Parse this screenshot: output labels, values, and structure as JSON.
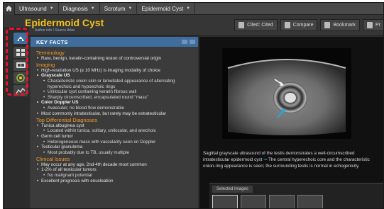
{
  "breadcrumb": {
    "items": [
      "Ultrasound",
      "Diagnosis",
      "Scrotum",
      "Epidermoid Cyst"
    ]
  },
  "header": {
    "title": "Epidermoid Cyst",
    "subtitle": "Author info / Source Atlas",
    "tools": [
      "Cited: Cited",
      "Compare",
      "Bookmark",
      "Pr"
    ]
  },
  "panel": {
    "title": "KEY FACTS",
    "terminology": {
      "heading": "Terminology",
      "items": [
        "Rare, benign, keratin-containing lesion of controversial origin"
      ]
    },
    "imaging": {
      "heading": "Imaging",
      "item1": "High-resolution US (≥ 10 MHz) is imaging modality of choice",
      "grayscale_label": "Grayscale US",
      "grayscale_items": [
        "Characteristic onion skin or lamellated appearance of alternating hyperechoic and hypoechoic rings",
        "Unilocular cyst containing keratin fibrous wall",
        "Sharply circumscribed, encapsulated round \"mass\""
      ],
      "doppler_label": "Color Doppler US",
      "doppler_items": [
        "Avascular; no blood flow demonstrable"
      ],
      "item_last": "Most commonly intratesticular, but rarely may be extratesticular"
    },
    "differential": {
      "heading": "Top Differential Diagnoses",
      "items": [
        "Tunica albuginea cyst",
        "Located within tunica, solitary, unilocular, and anechoic",
        "Germ cell tumor",
        "Heterogeneous mass with vascularity seen on Doppler",
        "Testicular granuloma",
        "Most probably due to TB, usually multiple"
      ]
    },
    "clinical": {
      "heading": "Clinical Issues",
      "items": [
        "May occur at any age, 2nd-4th decade most common",
        "1-2% of all testicular tumors",
        "No malignant potential",
        "Excellent prognosis with enucleation"
      ]
    }
  },
  "viewer": {
    "caption_pre": "Sagittal grayscale ultrasound of the testis demonstrates a well-circumscribed",
    "caption_main": "intratesticular epidermoid cyst",
    "caption_post": "The central hyperechoic core and the characteristic onion-ring appearance is seen; the surrounding testis is normal in echogenicity.",
    "thumbs_label": "Selected Images"
  },
  "colors": {
    "accent": "#f3c21c",
    "section": "#f09a2a",
    "panel_head": "#3f6e9e",
    "highlight": "#e8122b",
    "arrow": "#22a9e6"
  }
}
